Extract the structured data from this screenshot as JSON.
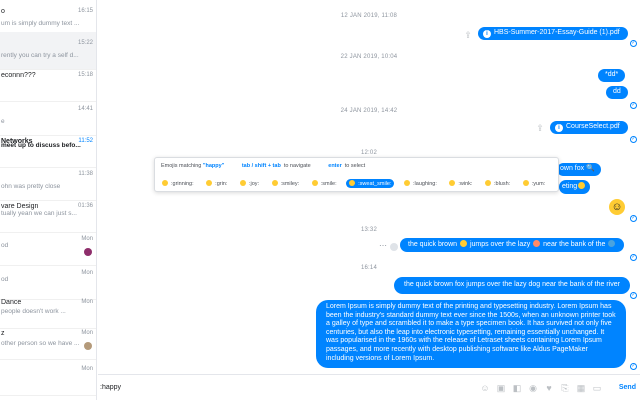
{
  "sidebar": {
    "conversations": [
      {
        "title": "o",
        "time": "16:15",
        "preview": "um is simply dummy text ..."
      },
      {
        "title": "",
        "time": "15:22",
        "preview": "rently you can try a self d..."
      },
      {
        "title": "econnn???",
        "time": "15:18",
        "preview": ""
      },
      {
        "title": "",
        "time": "14:41",
        "preview": "e"
      },
      {
        "title": "Networks",
        "time": "11:52",
        "preview": "meet up to discuss befo..."
      },
      {
        "title": "",
        "time": "11:38",
        "preview": "ohn was pretty close"
      },
      {
        "title": "vare Design",
        "time": "01:36",
        "preview": "tually yean we can just s..."
      },
      {
        "title": "",
        "time": "Mon",
        "preview": "od"
      },
      {
        "title": "",
        "time": "Mon",
        "preview": "od"
      },
      {
        "title": "Dance",
        "time": "Mon",
        "preview": "people doesn't work ..."
      },
      {
        "title": "z",
        "time": "Mon",
        "preview": "other person so we have ..."
      },
      {
        "title": "",
        "time": "Mon",
        "preview": ""
      }
    ]
  },
  "timeline": {
    "date1": "12 JAN 2019, 11:08",
    "date2": "22 JAN 2019, 10:04",
    "date3": "24 JAN 2019, 14:42",
    "time1": "12:02",
    "time2": "13:32",
    "time3": "16:14"
  },
  "messages": {
    "file1": "HBS-Summer-2017-Essay-Guide (1).pdf",
    "dd1": "*dd*",
    "dd2": "dd",
    "file2": "CourseSelect.pdf",
    "partial1": "own fox",
    "partial2": "eting",
    "emoji_msg_part1": "the quick brown",
    "emoji_msg_part2": "jumps over the lazy",
    "emoji_msg_part3": "near the bank of the",
    "plain_msg": "the quick brown fox jumps over the lazy dog near the bank of the river",
    "lorem": "Lorem Ipsum is simply dummy text of the printing and typesetting industry. Lorem Ipsum has been the industry's standard dummy text ever since the 1500s, when an unknown printer took a galley of type and scrambled it to make a type specimen book. It has survived not only five centuries, but also the leap into electronic typesetting, remaining essentially unchanged. It was popularised in the 1960s with the release of Letraset sheets containing Lorem Ipsum passages, and more recently with desktop publishing software like Aldus PageMaker including versions of Lorem Ipsum."
  },
  "emoji_popup": {
    "label": "Emojis matching",
    "query": "\"happy\"",
    "hint1_key": "tab / shift + tab",
    "hint1_text": "to navigate",
    "hint2_key": "enter",
    "hint2_text": "to select",
    "items": [
      ":grinning:",
      ":grin:",
      ":joy:",
      ":smiley:",
      ":smile:",
      ":sweat_smile:",
      ":laughing:",
      ":wink:",
      ":blush:",
      ":yum:"
    ],
    "selected_index": 5
  },
  "composer": {
    "value": ":happy",
    "send_label": "Send"
  },
  "colors": {
    "accent": "#0084ff",
    "emoji": "#ffcc33"
  }
}
